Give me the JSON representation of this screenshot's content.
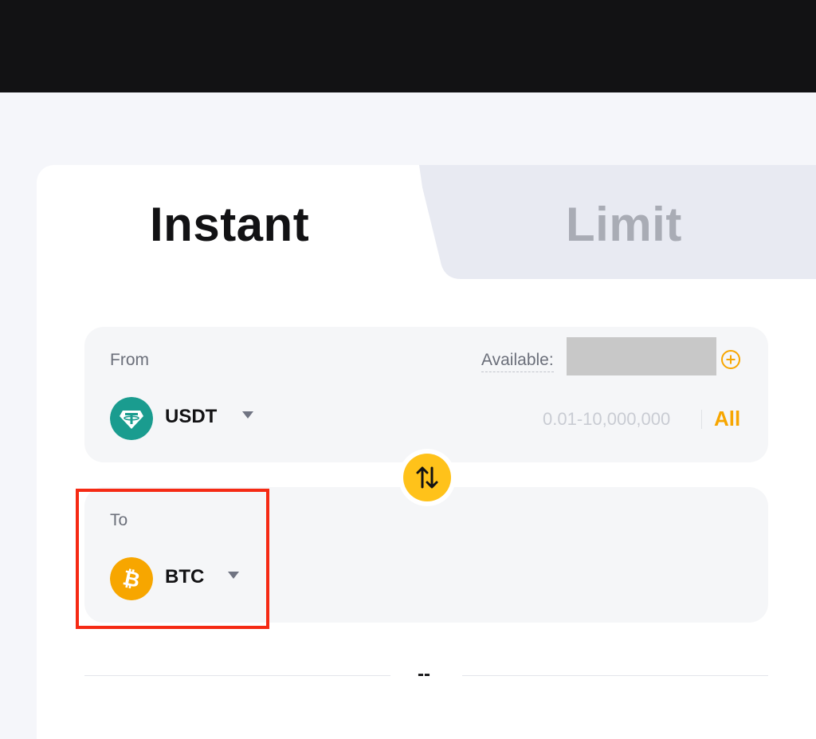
{
  "tabs": {
    "instant": "Instant",
    "limit": "Limit",
    "active": "Instant"
  },
  "from": {
    "label": "From",
    "available_label": "Available:",
    "coin": "USDT",
    "coin_icon": "tether-icon",
    "coin_color": "#1a9c8f",
    "range": "0.01-10,000,000",
    "all_label": "All"
  },
  "to": {
    "label": "To",
    "coin": "BTC",
    "coin_icon": "bitcoin-icon",
    "coin_color": "#f7a600"
  },
  "swap_icon": "swap-arrows-icon",
  "rate": "--",
  "colors": {
    "accent": "#f7a600",
    "swap_button": "#ffc21a",
    "highlight": "#f52a14",
    "topbar": "#121214"
  }
}
